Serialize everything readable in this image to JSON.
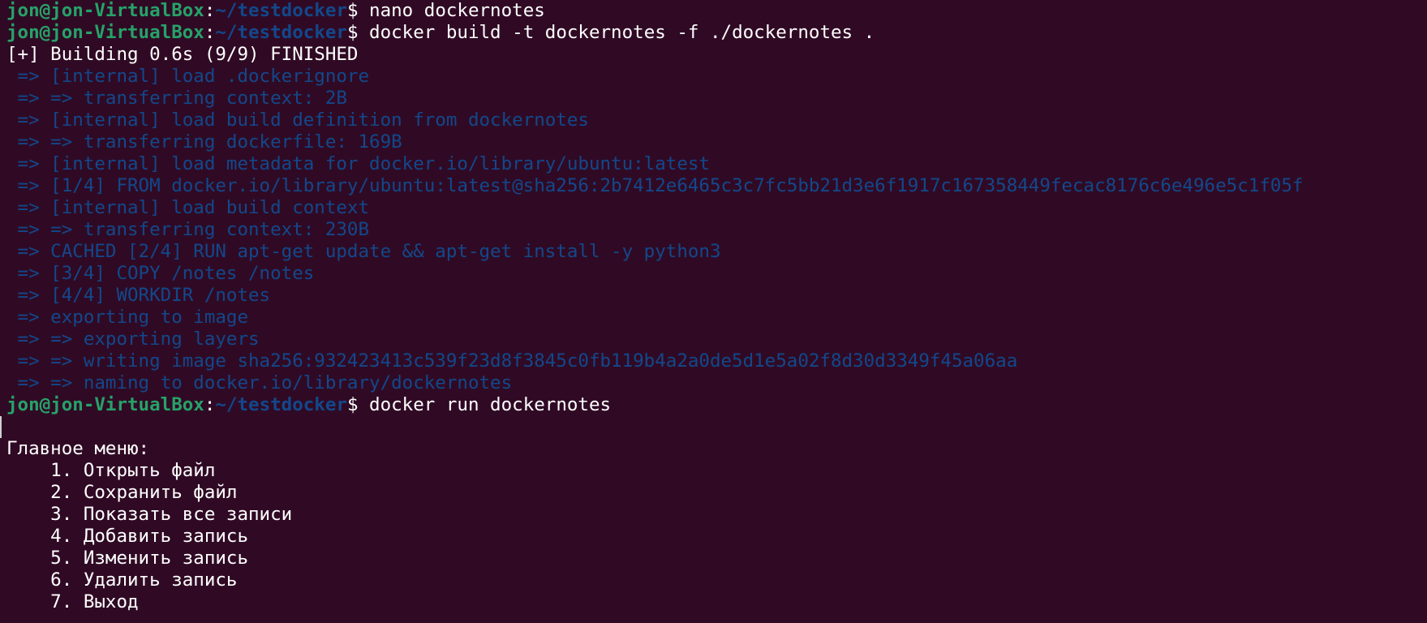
{
  "colors": {
    "background": "#300a24",
    "user_host": "#26a269",
    "path": "#12488b",
    "build_output": "#12488b",
    "text": "#ffffff"
  },
  "prompt": {
    "user_host": "jon@jon-VirtualBox",
    "separator": ":",
    "path": "~/testdocker",
    "symbol": "$ "
  },
  "commands": [
    "nano dockernotes",
    "docker build -t dockernotes -f ./dockernotes .",
    "docker run dockernotes"
  ],
  "build": {
    "header": "[+] Building 0.6s (9/9) FINISHED",
    "lines": [
      " => [internal] load .dockerignore",
      " => => transferring context: 2B",
      " => [internal] load build definition from dockernotes",
      " => => transferring dockerfile: 169B",
      " => [internal] load metadata for docker.io/library/ubuntu:latest",
      " => [1/4] FROM docker.io/library/ubuntu:latest@sha256:2b7412e6465c3c7fc5bb21d3e6f1917c167358449fecac8176c6e496e5c1f05f",
      " => [internal] load build context",
      " => => transferring context: 230B",
      " => CACHED [2/4] RUN apt-get update && apt-get install -y python3",
      " => [3/4] COPY /notes /notes",
      " => [4/4] WORKDIR /notes",
      " => exporting to image",
      " => => exporting layers",
      " => => writing image sha256:932423413c539f23d8f3845c0fb119b4a2a0de5d1e5a02f8d30d3349f45a06aa",
      " => => naming to docker.io/library/dockernotes"
    ]
  },
  "menu": {
    "title": "Главное меню:",
    "items": [
      "    1. Открыть файл",
      "    2. Сохранить файл",
      "    3. Показать все записи",
      "    4. Добавить запись",
      "    5. Изменить запись",
      "    6. Удалить запись",
      "    7. Выход"
    ]
  }
}
